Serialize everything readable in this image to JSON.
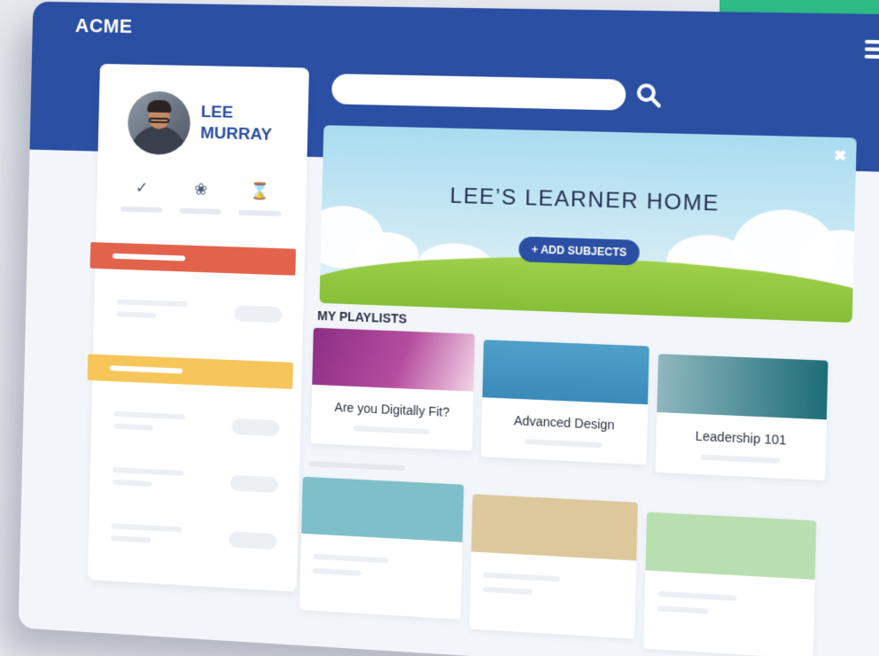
{
  "brand": "ACME",
  "profile": {
    "first_name": "LEE",
    "last_name": "MURRAY"
  },
  "stats": [
    {
      "icon": "check-circle-icon",
      "glyph": "✓"
    },
    {
      "icon": "award-icon",
      "glyph": "❀"
    },
    {
      "icon": "hourglass-icon",
      "glyph": "⌛"
    }
  ],
  "hero": {
    "title": "LEE’S LEARNER HOME",
    "add_subjects_label": "+ ADD SUBJECTS",
    "close_glyph": "✖"
  },
  "playlists": {
    "title": "MY PLAYLISTS",
    "items": [
      {
        "title": "Are you Digitally Fit?"
      },
      {
        "title": "Advanced Design"
      },
      {
        "title": "Leadership 101"
      }
    ]
  },
  "colors": {
    "header": "#2b4fa3",
    "accent_red": "#e3624c",
    "accent_yellow": "#f6c65b",
    "placeholder_teal": "#7fbfc9",
    "placeholder_tan": "#dcc89b",
    "placeholder_green": "#b9dfb0",
    "side_green": "#2ebd86"
  }
}
